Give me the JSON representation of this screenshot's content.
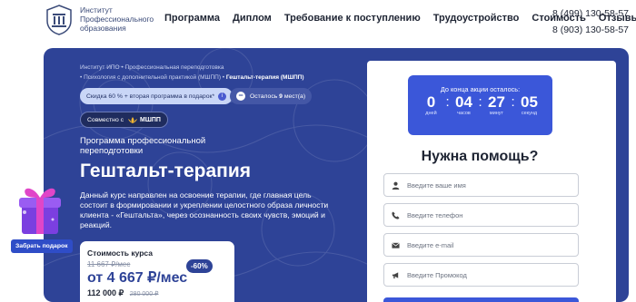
{
  "header": {
    "brand_line1": "Институт",
    "brand_line2": "Профессионального",
    "brand_line3": "образования",
    "nav": [
      "Программа",
      "Диплом",
      "Требование к поступлению",
      "Трудоустройство",
      "Стоимость",
      "Отзывы"
    ],
    "phone1": "8 (499) 130-58-57",
    "phone2": "8 (903) 130-58-57"
  },
  "breadcrumbs": {
    "line1_a": "Институт ИПО",
    "line1_b": "Профессиональная переподготовка",
    "line2_a": "Психология с дополнительной практикой (МШПП)",
    "line2_b": "Гештальт-терапия (МШПП)"
  },
  "pills": {
    "discount": "Скидка 60 % + вторая программа в подарок*",
    "seats_prefix": "Осталось",
    "seats_count": "9",
    "seats_suffix": "мест(а)",
    "with_label": "Совместно с",
    "partner": "МШПП"
  },
  "program": {
    "subtitle": "Программа профессиональной переподготовки",
    "title": "Гештальт-терапия",
    "description": "Данный курс направлен на освоение терапии, где главная цель состоит в формировании и укреплении целостного образа личности клиента - «Гештальта», через осознанность своих чувств, эмоций и реакций."
  },
  "price": {
    "label": "Стоимость курса",
    "old_monthly": "11 667 ₽/мес",
    "new_monthly": "от 4 667 ₽/мес",
    "discount_badge": "-60%",
    "total": "112 000 ₽",
    "total_old": "280 000 ₽"
  },
  "countdown": {
    "label": "До конца акции осталось:",
    "days": "0",
    "hours": "04",
    "minutes": "27",
    "seconds": "05",
    "unit_days": "дней",
    "unit_hours": "часов",
    "unit_minutes": "минут",
    "unit_seconds": "секунд"
  },
  "form": {
    "title": "Нужна помощь?",
    "name_placeholder": "Введите ваше имя",
    "phone_placeholder": "Введите телефон",
    "email_placeholder": "Введите e-mail",
    "promo_placeholder": "Введите Промокод"
  },
  "gift": {
    "button": "Забрать подарок"
  },
  "colors": {
    "hero_bg": "#2e4397",
    "accent": "#3b57d9",
    "text_dark": "#1e2433"
  }
}
